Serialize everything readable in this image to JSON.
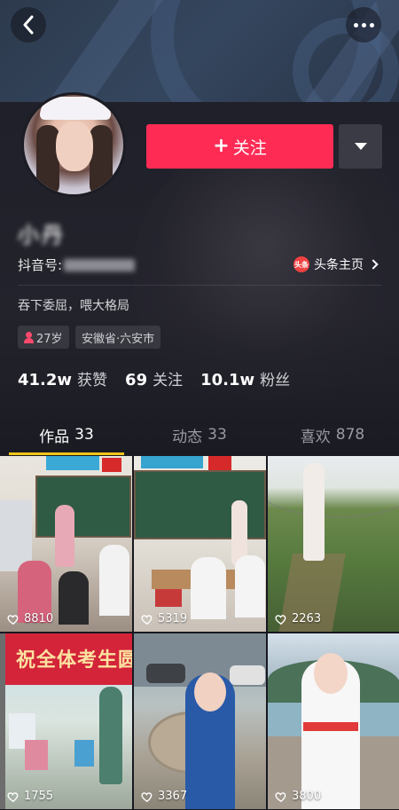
{
  "header": {
    "back_icon": "chevron-left-icon",
    "more_icon": "more-dots-icon"
  },
  "profile": {
    "follow_label": "关注",
    "follow_plus": "+",
    "nickname": "小丹",
    "douyin_id_label": "抖音号:",
    "douyin_id_value": "xxxxxxxx",
    "toutiao_badge": "头条",
    "toutiao_label": "头条主页",
    "bio": "吞下委屈，喂大格局",
    "age_tag": "27岁",
    "location_tag": "安徽省·六安市",
    "accent_color": "#fe2c55"
  },
  "stats": [
    {
      "value": "41.2w",
      "label": "获赞"
    },
    {
      "value": "69",
      "label": "关注"
    },
    {
      "value": "10.1w",
      "label": "粉丝"
    }
  ],
  "tabs": [
    {
      "label": "作品",
      "count": "33",
      "active": true
    },
    {
      "label": "动态",
      "count": "33",
      "active": false
    },
    {
      "label": "喜欢",
      "count": "878",
      "active": false
    }
  ],
  "videos": [
    {
      "likes": "8810"
    },
    {
      "likes": "5319"
    },
    {
      "likes": "2263"
    },
    {
      "likes": "1755",
      "sign_text": "祝全体考生圆"
    },
    {
      "likes": "3367"
    },
    {
      "likes": "3800"
    }
  ]
}
